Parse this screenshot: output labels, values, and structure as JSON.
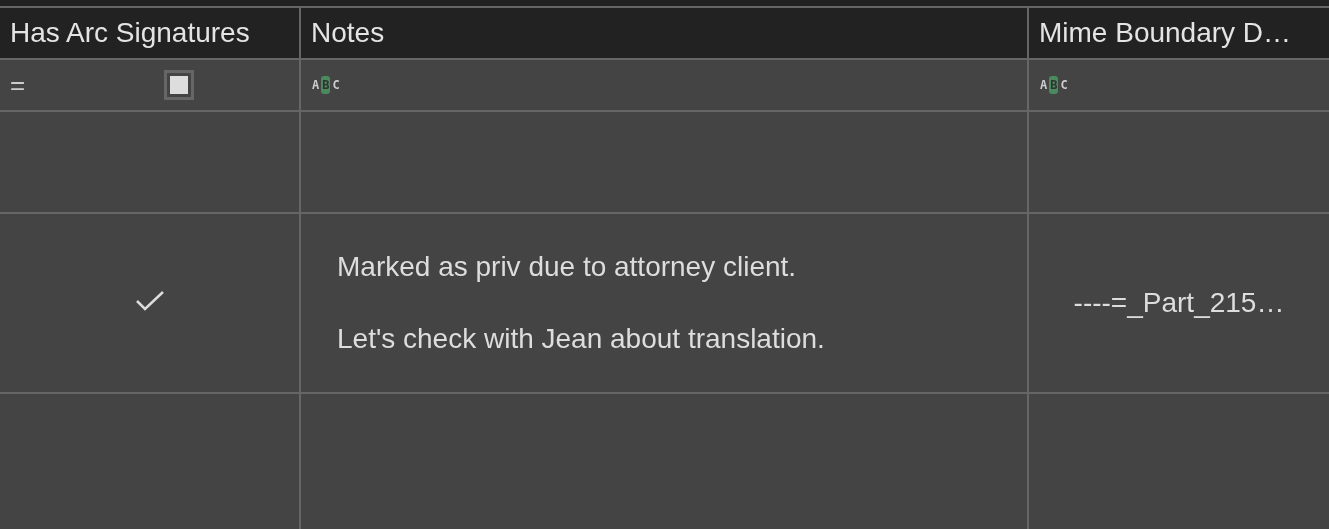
{
  "table": {
    "columns": [
      {
        "label": "Has Arc Signatures",
        "filter": {
          "kind": "checkbox",
          "indeterminate": true
        },
        "filter_menu": "="
      },
      {
        "label": "Notes",
        "filter": {
          "kind": "text",
          "letters": [
            "A",
            "B",
            "C"
          ]
        }
      },
      {
        "label": "Mime Boundary D…",
        "filter": {
          "kind": "text",
          "letters": [
            "A",
            "B",
            "C"
          ]
        }
      }
    ],
    "rows": [
      {
        "checked": false
      },
      {
        "checked": true,
        "notes": [
          "Marked as priv due to attorney client.",
          "Let's check with Jean about translation."
        ],
        "mime": "----=_Part_215…"
      },
      {
        "checked": false
      }
    ]
  }
}
